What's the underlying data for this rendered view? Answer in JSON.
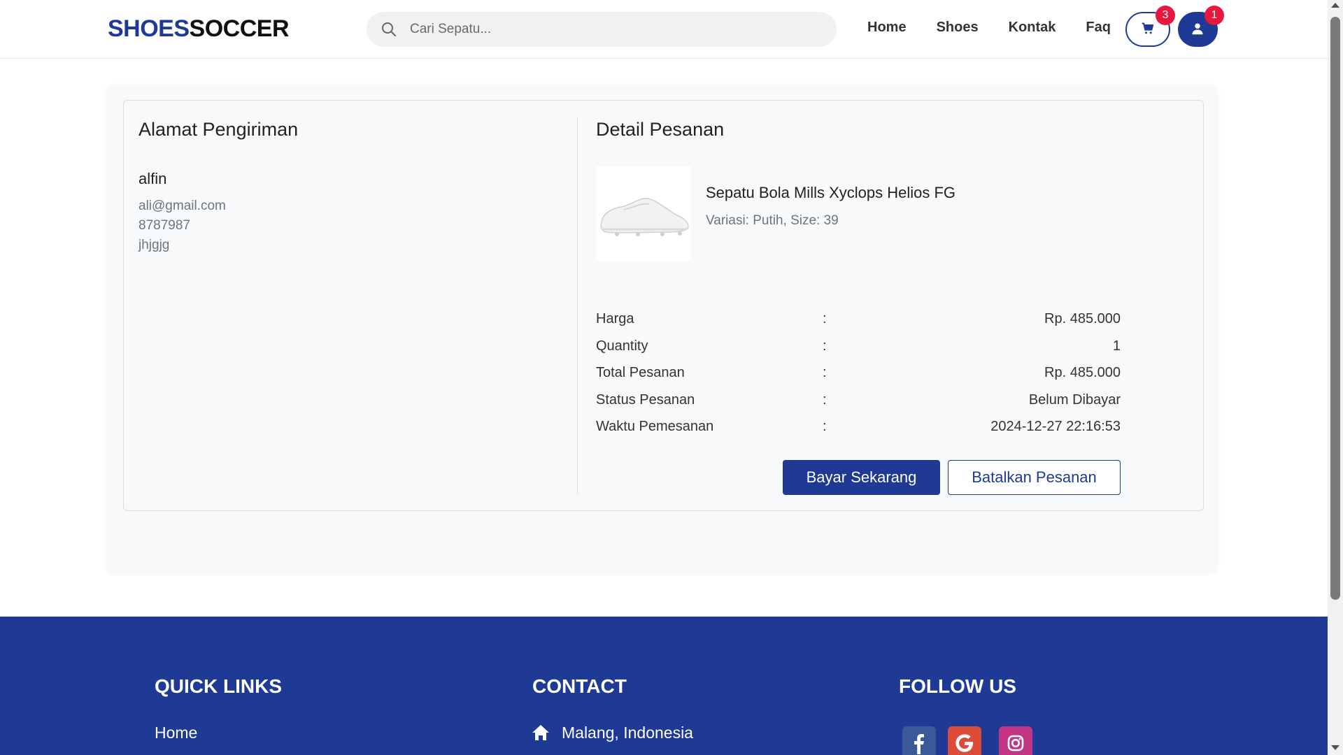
{
  "navbar": {
    "logo_part1": "SHOES",
    "logo_part2": "SOCCER",
    "search_placeholder": "Cari Sepatu...",
    "links": [
      "Home",
      "Shoes",
      "Kontak",
      "Faq"
    ],
    "cart_count": "3",
    "user_count": "1",
    "brand_color": "#1e3a94",
    "badge_color": "#e8173d"
  },
  "address": {
    "heading": "Alamat Pengiriman",
    "name": "alfin",
    "email": "ali@gmail.com",
    "phone": "8787987",
    "address": "jhjgjg"
  },
  "order": {
    "heading": "Detail Pesanan",
    "product_name": "Sepatu Bola Mills Xyclops Helios FG",
    "variant": "Variasi: Putih, Size: 39",
    "rows": [
      {
        "label": "Harga",
        "sep": ":",
        "value": "Rp. 485.000"
      },
      {
        "label": "Quantity",
        "sep": ":",
        "value": "1"
      },
      {
        "label": "Total Pesanan",
        "sep": ":",
        "value": "Rp. 485.000"
      },
      {
        "label": "Status Pesanan",
        "sep": ":",
        "value": "Belum Dibayar"
      },
      {
        "label": "Waktu Pemesanan",
        "sep": ":",
        "value": "2024-12-27 22:16:53"
      }
    ],
    "pay_button": "Bayar Sekarang",
    "cancel_button": "Batalkan Pesanan"
  },
  "footer": {
    "quick_links_heading": "QUICK LINKS",
    "contact_heading": "CONTACT",
    "follow_heading": "FOLLOW US",
    "first_link": "Home",
    "location": "Malang, Indonesia",
    "socials": [
      {
        "icon": "facebook-icon",
        "color": "#3b5998"
      },
      {
        "icon": "google-icon",
        "color": "#dd4b39"
      },
      {
        "icon": "instagram-icon",
        "color": "#c13584"
      }
    ]
  }
}
